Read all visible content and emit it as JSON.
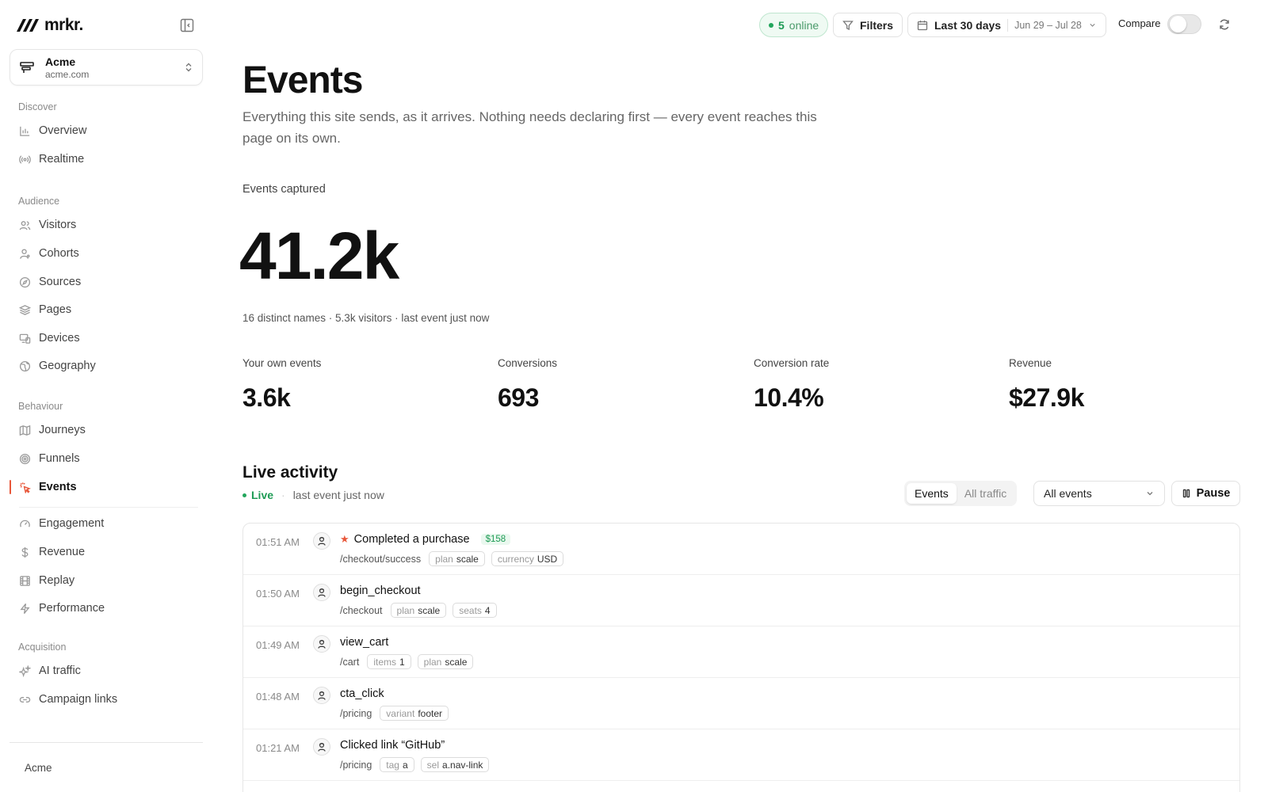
{
  "brand": {
    "name": "mrkr."
  },
  "workspace": {
    "name": "Acme",
    "domain": "acme.com"
  },
  "sidebar": {
    "sections": [
      {
        "title": "Discover",
        "items": [
          {
            "label": "Overview",
            "icon": "bar-chart-icon"
          },
          {
            "label": "Realtime",
            "icon": "broadcast-icon"
          }
        ]
      },
      {
        "title": "Audience",
        "items": [
          {
            "label": "Visitors",
            "icon": "users-icon"
          },
          {
            "label": "Cohorts",
            "icon": "user-group-icon"
          },
          {
            "label": "Sources",
            "icon": "compass-icon"
          },
          {
            "label": "Pages",
            "icon": "layers-icon"
          },
          {
            "label": "Devices",
            "icon": "devices-icon"
          },
          {
            "label": "Geography",
            "icon": "globe-icon"
          }
        ]
      },
      {
        "title": "Behaviour",
        "items": [
          {
            "label": "Journeys",
            "icon": "map-icon"
          },
          {
            "label": "Funnels",
            "icon": "target-icon"
          },
          {
            "label": "Events",
            "icon": "cursor-click-icon",
            "active": true
          },
          {
            "label": "Engagement",
            "icon": "gauge-icon"
          },
          {
            "label": "Revenue",
            "icon": "dollar-icon"
          },
          {
            "label": "Replay",
            "icon": "film-icon"
          },
          {
            "label": "Performance",
            "icon": "bolt-icon"
          }
        ]
      },
      {
        "title": "Acquisition",
        "items": [
          {
            "label": "AI traffic",
            "icon": "sparkles-icon"
          },
          {
            "label": "Campaign links",
            "icon": "link-icon"
          }
        ]
      }
    ],
    "footer": "Acme"
  },
  "topbar": {
    "online_count": "5",
    "online_label": "online",
    "filters_label": "Filters",
    "range_label": "Last 30 days",
    "range_dates": "Jun 29 – Jul 28",
    "compare_label": "Compare",
    "compare_on": false
  },
  "main": {
    "title": "Events",
    "description": "Everything this site sends, as it arrives. Nothing needs declaring first — every event reaches this page on its own.",
    "captured_label": "Events captured",
    "captured_value": "41.2k",
    "captured_meta": "16 distinct names · 5.3k visitors · last event just now",
    "stats": [
      {
        "label": "Your own events",
        "value": "3.6k"
      },
      {
        "label": "Conversions",
        "value": "693"
      },
      {
        "label": "Conversion rate",
        "value": "10.4%"
      },
      {
        "label": "Revenue",
        "value": "$27.9k"
      }
    ]
  },
  "live": {
    "title": "Live activity",
    "status": "Live",
    "last_event": "last event just now",
    "tabs": [
      "Events",
      "All traffic"
    ],
    "filter_value": "All events",
    "pause_label": "Pause",
    "events": [
      {
        "time": "01:51 AM",
        "name": "Completed a purchase",
        "conversion": true,
        "amount": "$158",
        "path": "/checkout/success",
        "props": [
          {
            "k": "plan",
            "v": "scale"
          },
          {
            "k": "currency",
            "v": "USD"
          }
        ]
      },
      {
        "time": "01:50 AM",
        "name": "begin_checkout",
        "path": "/checkout",
        "props": [
          {
            "k": "plan",
            "v": "scale"
          },
          {
            "k": "seats",
            "v": "4"
          }
        ]
      },
      {
        "time": "01:49 AM",
        "name": "view_cart",
        "path": "/cart",
        "props": [
          {
            "k": "items",
            "v": "1"
          },
          {
            "k": "plan",
            "v": "scale"
          }
        ]
      },
      {
        "time": "01:48 AM",
        "name": "cta_click",
        "path": "/pricing",
        "props": [
          {
            "k": "variant",
            "v": "footer"
          }
        ]
      },
      {
        "time": "01:21 AM",
        "name": "Clicked link “GitHub”",
        "path": "/pricing",
        "props": [
          {
            "k": "tag",
            "v": "a"
          },
          {
            "k": "sel",
            "v": "a.nav-link"
          }
        ]
      }
    ]
  },
  "colors": {
    "accent": "#e8573a",
    "live_green": "#22a65c"
  }
}
